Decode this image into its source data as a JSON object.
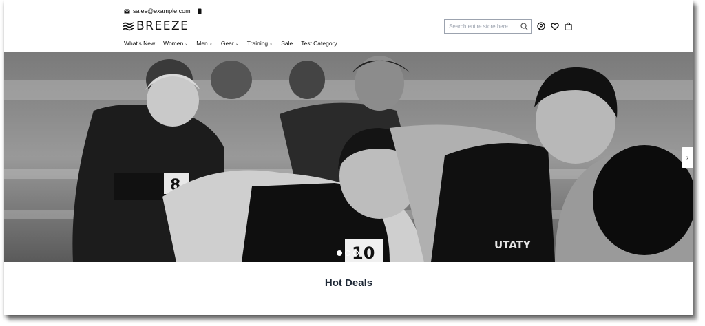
{
  "topbar": {
    "email": "sales@example.com",
    "mail_icon": "mail-icon",
    "phone_icon": "phone-icon"
  },
  "header": {
    "logo_text": "BREEZE",
    "search_placeholder": "Search entire store here...",
    "icons": [
      "account-icon",
      "wishlist-heart-icon",
      "cart-bag-icon"
    ]
  },
  "nav": {
    "items": [
      {
        "label": "What's New",
        "dropdown": false
      },
      {
        "label": "Women",
        "dropdown": true
      },
      {
        "label": "Men",
        "dropdown": true
      },
      {
        "label": "Gear",
        "dropdown": true
      },
      {
        "label": "Training",
        "dropdown": true
      },
      {
        "label": "Sale",
        "dropdown": false
      },
      {
        "label": "Test Category",
        "dropdown": false
      }
    ]
  },
  "slider": {
    "next_arrow": "›",
    "slide_count": 3,
    "active_slide": 1,
    "bibs": [
      "8",
      "10"
    ],
    "jersey_text": "UTATY"
  },
  "section": {
    "title": "Hot Deals"
  }
}
